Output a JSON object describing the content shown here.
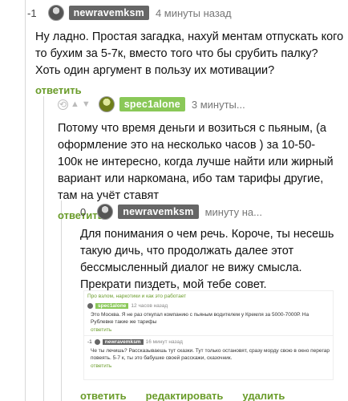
{
  "comments": [
    {
      "score": "-1",
      "username": "newravemksm",
      "time": "4 минуты назад",
      "text": "Ну ладно. Простая загадка, нахуй ментам отпускать кого то бухим за 5-7к, вместо того что бы срубить палку? Хоть один аргумент в пользу их мотивации?",
      "reply": "ответить"
    },
    {
      "username": "spec1alone",
      "time": "3 минуты...",
      "text": "Потому что время деньги и возиться с пьяным, (а оформление это на несколько часов ) за 10-50-100к не интересно, когда лучше найти или жирный вариант или наркомана, ибо там тарифы другие, там на учёт ставят",
      "reply": "ответить"
    },
    {
      "score": "0",
      "username": "newravemksm",
      "time": "минуту на...",
      "text": "Для понимания о чем речь. Короче, ты несешь такую дичь, что продолжать далее этот бессмысленный диалог не вижу смысла. Прекрати пиздеть, мой тебе совет.",
      "reply": "ответить",
      "edit": "редактировать",
      "delete": "удалить"
    }
  ],
  "screenshot": {
    "breadcrumb": "Про взлом, наркотики и как это работает",
    "c1_user": "spec1alone",
    "c1_time": "12 часов назад",
    "c1_text": "Это Москва. Я не раз откупал компанию с пьяным водителем у Кремля за 5000-7000Р. На Рублевке такие же тарифы",
    "c1_reply": "ответить",
    "c2_score": "-1",
    "c2_user": "newravemksm",
    "c2_time": "16 минут назад",
    "c2_text": "Че ты лечишь? Рассказываешь тут сказки. Тут только остановят, сразу морду свою в окно перегар повеять. 5-7 к, ты это бабушке своей расскажи, сказочник.",
    "c2_reply": "ответить"
  }
}
